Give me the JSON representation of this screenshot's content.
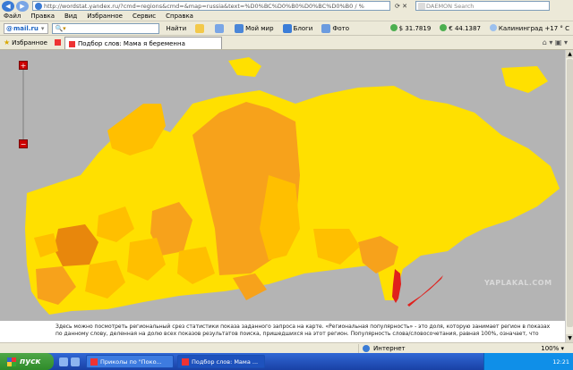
{
  "browser": {
    "address": "http://wordstat.yandex.ru/?cmd=regions&cmd=&map=russia&text=%D0%BC%D0%B0%D0%BC%D0%B0 / %",
    "search_placeholder": "DAEMON Search"
  },
  "menu": [
    "Файл",
    "Правка",
    "Вид",
    "Избранное",
    "Сервис",
    "Справка"
  ],
  "toolbar": {
    "mailru": "mail.ru",
    "find_label": "Найти",
    "my_world": "Мой мир",
    "blogs": "Блоги",
    "photo": "Фото",
    "usd": "$ 31.7819",
    "eur": "€ 44.1387",
    "weather": "Калининград +17 ° C"
  },
  "tabs": {
    "favorites": "Избранное",
    "active_tab": "Подбор слов: Мама я беременна"
  },
  "page": {
    "caption": "Здесь можно посмотреть региональный срез статистики показа заданного запроса на карте. «Региональная популярность» - это доля, которую занимает регион в показах по данному слову, деленная на долю всех показов результатов поиска, пришедшихся на этот регион. Популярность слова/словосочетания, равная 100%, означает, что",
    "zoom_in": "+",
    "zoom_out": "−"
  },
  "status": {
    "zone": "Интернет",
    "zoom": "100%"
  },
  "taskbar": {
    "start": "пуск",
    "tasks": [
      "Приколы по \"Поко...",
      "Подбор слов: Мама ..."
    ],
    "clock": "12:21"
  },
  "watermark": "YAPLAKAL.COM",
  "colors": {
    "map_background": "#b4b4b4",
    "region_yellow": "#ffe000",
    "region_light_orange": "#ffbf00",
    "region_orange": "#f7a21b",
    "region_dark_orange": "#e8870c",
    "region_red": "#e0201c"
  }
}
